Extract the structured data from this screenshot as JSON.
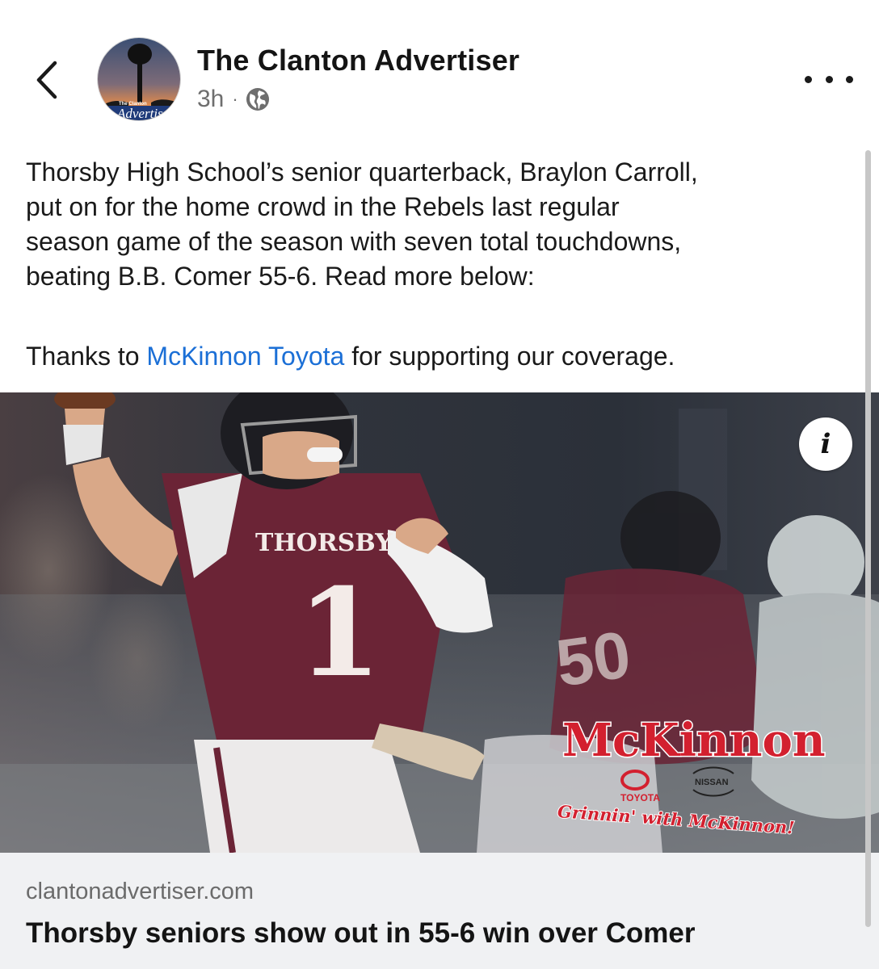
{
  "header": {
    "page_name": "The Clanton Advertiser",
    "timestamp": "3h",
    "separator": "·",
    "avatar_text": "The Clanton",
    "avatar_script": "Advertiser",
    "icons": {
      "back": "chevron-left-icon",
      "audience": "globe-icon",
      "more": "more-horizontal-icon"
    }
  },
  "post": {
    "text": "Thorsby High School’s senior quarterback, Braylon Carroll,\nput on for the home crowd in the Rebels last regular\nseason game of the season with seven total touchdowns,\nbeating B.B. Comer 55-6. Read more below:",
    "thanks_prefix": "Thanks to ",
    "thanks_link": "McKinnon Toyota",
    "thanks_suffix": " for supporting our coverage."
  },
  "photo": {
    "jersey_text": "THORSBY",
    "jersey_number": "1",
    "background_number": "50",
    "sponsor_name": "McKinnon",
    "sponsor_brand_left": "TOYOTA",
    "sponsor_brand_right": "NISSAN",
    "sponsor_tagline": "Grinnin' with McKinnon!",
    "info_label": "i"
  },
  "link_preview": {
    "domain": "clantonadvertiser.com",
    "headline": "Thorsby seniors show out in 55-6 win over Comer"
  },
  "colors": {
    "link": "#1b6fd6",
    "maroon": "#6b2436",
    "sponsor_red": "#d3202f",
    "preview_bg": "#f0f1f3"
  }
}
